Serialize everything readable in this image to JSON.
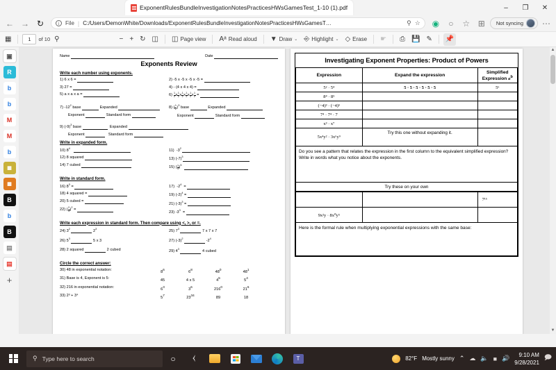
{
  "browser": {
    "tab": {
      "title": "ExponentRulesBundleInvestigationNotesPracticesHWsGamesTest_1-10 (1).pdf",
      "favicon": "pdf-icon"
    },
    "window_controls": {
      "minimize": "–",
      "maximize": "❐",
      "close": "✕"
    },
    "nav": {
      "back": "←",
      "forward": "→",
      "refresh": "↻"
    },
    "omnibox": {
      "info_glyph": "i",
      "scheme_label": "File",
      "separator": "|",
      "url": "C:/Users/DemonWhite/Downloads/ExponentRulesBundleInvestigationNotesPracticesHWsGamesT…",
      "find_icon": "search-icon",
      "favorite_icon": "star-add-icon"
    },
    "right_actions": {
      "copilot": "copilot-icon",
      "history": "history-icon",
      "favorites": "favorites-icon",
      "collections": "collections-icon",
      "profile_label": "Not syncing",
      "more": "⋯"
    }
  },
  "pdf_toolbar": {
    "sidebar_toggle": "page-panel-icon",
    "page_number": "1",
    "page_total": "of 10",
    "search": "search-icon",
    "zoom_out": "−",
    "zoom_in": "+",
    "rotate": "rotate-icon",
    "fit_page": "fit-page-icon",
    "page_view": "Page view",
    "read_aloud": "Read aloud",
    "draw": "Draw",
    "highlight": "Highlight",
    "erase": "Erase",
    "caret": "⌄",
    "select_text": "select-text-icon",
    "print": "print-icon",
    "save": "save-icon",
    "annotate": "annotate-icon",
    "pin": "pin-icon"
  },
  "edge_sidebar": {
    "items": [
      {
        "name": "browser-essentials",
        "glyph": "▣",
        "color": "#ffffff",
        "text": "#555555"
      },
      {
        "name": "app-r",
        "glyph": "R",
        "color": "#2bbbd8",
        "text": "#ffffff"
      },
      {
        "name": "app-b-1",
        "glyph": "b",
        "color": "#ffffff",
        "text": "#2f7fe0"
      },
      {
        "name": "app-b-2",
        "glyph": "b",
        "color": "#ffffff",
        "text": "#2f7fe0"
      },
      {
        "name": "app-m-red",
        "glyph": "M",
        "color": "#ffffff",
        "text": "#d93025"
      },
      {
        "name": "app-gmail",
        "glyph": "M",
        "color": "#ffffff",
        "text": "#d93025"
      },
      {
        "name": "app-b-3",
        "glyph": "b",
        "color": "#ffffff",
        "text": "#2f7fe0"
      },
      {
        "name": "app-green-card",
        "glyph": "▬",
        "color": "#c9b23a",
        "text": "#ffffff"
      },
      {
        "name": "app-orange-card",
        "glyph": "▬",
        "color": "#e07b20",
        "text": "#ffffff"
      },
      {
        "name": "app-black-b-1",
        "glyph": "B",
        "color": "#111111",
        "text": "#ffffff"
      },
      {
        "name": "app-b-4",
        "glyph": "b",
        "color": "#ffffff",
        "text": "#2f7fe0"
      },
      {
        "name": "app-black-b-2",
        "glyph": "B",
        "color": "#111111",
        "text": "#ffffff"
      },
      {
        "name": "app-grey-doc",
        "glyph": "▤",
        "color": "#ffffff",
        "text": "#8a8a8a"
      },
      {
        "name": "app-pdf-selected",
        "glyph": "▤",
        "color": "#ffffff",
        "text": "#e8443a"
      }
    ],
    "add_button": "+"
  },
  "worksheet": {
    "name_label": "Name",
    "date_label": "Date",
    "title": "Exponents Review",
    "sections": [
      {
        "heading": "Write each number using exponents.",
        "items_left": [
          "1)  6 x 6 =",
          "3)  27 =",
          "5)  a x a x a ="
        ],
        "items_right": [
          "2) -5 x -5 x -5 x -5 =",
          "4) - (4 x 4 x 4) =",
          "6)  ½ x ½ x ½ x ½ x ½ x ½  ="
        ]
      }
    ],
    "baseexp": {
      "q7": {
        "num": "7)  -12",
        "sup": "2",
        "base": "base",
        "expanded": "Expanded",
        "exponent": "Exponent",
        "standard": "Standard form"
      },
      "q8": {
        "num": "8)",
        "frac_num": "1",
        "frac_den": "2",
        "sup": "3",
        "base": "base",
        "expanded": "Expanded",
        "exponent": "Exponent",
        "standard": "Standard form"
      },
      "q9": {
        "num": "9)  (-9)",
        "sup": "3",
        "base": "base",
        "expanded": "Expanded",
        "exponent": "Exponent",
        "standard": "Standard form"
      }
    },
    "expanded_heading": "Write in expanded form.",
    "expanded_left": [
      {
        "n": "10)",
        "expr": "8",
        "sup": "4"
      },
      {
        "n": "12)",
        "expr": "8 squared",
        "sup": ""
      },
      {
        "n": "14)",
        "expr": "7 cubed",
        "sup": ""
      }
    ],
    "expanded_right": [
      {
        "n": "11)",
        "expr": "-3",
        "sup": "2"
      },
      {
        "n": "13)",
        "expr": "(-7)",
        "sup": "3"
      },
      {
        "n": "15)",
        "expr": "frac",
        "frac_num": "3",
        "frac_den": "4",
        "sup": "5"
      }
    ],
    "standard_heading": "Write in standard form.",
    "standard_left": [
      {
        "n": "16)",
        "expr": "8",
        "sup": "3",
        "eq": "="
      },
      {
        "n": "18)",
        "expr": "4 squared",
        "sup": "",
        "eq": "="
      },
      {
        "n": "20)",
        "expr": "5 cubed",
        "sup": "",
        "eq": "="
      },
      {
        "n": "22)",
        "expr": "frac",
        "frac_num": "2",
        "frac_den": "4",
        "sup": "2",
        "eq": "="
      }
    ],
    "standard_right": [
      {
        "n": "17)",
        "expr": "-2",
        "sup": "4",
        "eq": "="
      },
      {
        "n": "19)",
        "expr": "(-2)",
        "sup": "4",
        "eq": "="
      },
      {
        "n": "21)",
        "expr": "(-3)",
        "sup": "3",
        "eq": "="
      },
      {
        "n": "23)",
        "expr": "-3",
        "sup": "3",
        "eq": "="
      }
    ],
    "compare_heading": "Write each expression in standard form.  Then compare using <, >, or =.",
    "compare_left": [
      {
        "n": "24)",
        "a": "3",
        "asup": "2",
        "b": "2",
        "bsup": "3"
      },
      {
        "n": "26)",
        "a": "5",
        "asup": "3",
        "b": "5 x 3",
        "bsup": ""
      },
      {
        "n": "28)",
        "a": "2 squared",
        "asup": "",
        "b": "2 cubed",
        "bsup": ""
      }
    ],
    "compare_right": [
      {
        "n": "25)",
        "a": "7",
        "asup": "3",
        "b": "7 x 7 x 7",
        "bsup": ""
      },
      {
        "n": "27)",
        "a": "(-3)",
        "asup": "2",
        "b": "-2",
        "bsup": "4"
      },
      {
        "n": "29)",
        "a": "4",
        "asup": "3",
        "b": "4 cubed",
        "bsup": ""
      }
    ],
    "circle_heading": "Circle the correct answer:",
    "circle_rows": [
      {
        "q": "30) 48 in exponential notation:",
        "opts": [
          {
            "t": "8",
            "s": "6"
          },
          {
            "t": "6",
            "s": "8"
          },
          {
            "t": "48",
            "s": "0"
          },
          {
            "t": "48",
            "s": "1"
          }
        ]
      },
      {
        "q": "31) Base is 4, Exponent is 5:",
        "opts": [
          {
            "t": "45",
            "s": ""
          },
          {
            "t": "4 x 5",
            "s": ""
          },
          {
            "t": "4",
            "s": "5"
          },
          {
            "t": "5",
            "s": "4"
          }
        ]
      },
      {
        "q": "32)  216 in exponential notation:",
        "opts": [
          {
            "t": "6",
            "s": "3"
          },
          {
            "t": "3",
            "s": "6"
          },
          {
            "t": "216",
            "s": "0"
          },
          {
            "t": "21",
            "s": "6"
          }
        ]
      },
      {
        "q": "33)  2³ + 3⁴",
        "opts": [
          {
            "t": "5",
            "s": "7"
          },
          {
            "t": "23",
            "s": "34"
          },
          {
            "t": "89",
            "s": ""
          },
          {
            "t": "18",
            "s": ""
          }
        ]
      }
    ]
  },
  "investigation": {
    "title": "Investigating Exponent Properties: Product of Powers",
    "headers": {
      "c1": "Expression",
      "c2": "Expand the expression",
      "c3_line1": "Simplified",
      "c3_line2": "Expression ",
      "c3_italic": "a",
      "c3_sup": "b"
    },
    "rows": [
      {
        "expression": "5² · 5⁴",
        "expand": "5 · 5 · 5 · 5 · 5 · 5",
        "simplified": "5⁶"
      },
      {
        "expression": "8⁴ · 8⁵",
        "expand": "",
        "simplified": ""
      },
      {
        "expression": "(−4)³ · (−4)⁵",
        "expand": "",
        "simplified": ""
      },
      {
        "expression": "7⁴ · 7⁴ · 7",
        "expand": "",
        "simplified": ""
      },
      {
        "expression": "x³ · x⁷",
        "expand": "",
        "simplified": ""
      },
      {
        "expression": "5x⁴y² · 3x⁶y⁹",
        "expand": "Try this one without expanding it.",
        "simplified": ""
      }
    ],
    "pattern_prompt": "Do you see a pattern that relates the expression in the first column to the equivalent simplified expression?  Write in words what you notice about the exponents.",
    "try_band": "Try these on your own",
    "try_rows": [
      {
        "expression": "",
        "expand": "",
        "simplified": "7¹⁵"
      },
      {
        "expression": "9x²y · 8x⁰y⁵",
        "expand": "",
        "simplified": ""
      }
    ],
    "formal_rule": "Here is the formal rule when multiplying exponential expressions with the same base:"
  },
  "taskbar": {
    "search_placeholder": "Type here to search",
    "items": [
      {
        "name": "cortana-icon",
        "glyph": "○"
      },
      {
        "name": "task-view-icon",
        "glyph": "⫼"
      },
      {
        "name": "file-explorer-icon",
        "glyph": "🗀"
      },
      {
        "name": "microsoft-store-icon",
        "glyph": "🛍"
      },
      {
        "name": "mail-icon",
        "glyph": "✉"
      },
      {
        "name": "microsoft-edge-icon",
        "glyph": "◑"
      },
      {
        "name": "microsoft-teams-icon",
        "glyph": "⬟"
      }
    ],
    "weather": {
      "temp": "82°F",
      "condition": "Mostly sunny"
    },
    "tray": {
      "show_hidden": "⌃",
      "onedrive": "onedrive-icon",
      "mic": "microphone-icon",
      "battery": "battery-icon",
      "volume": "volume-icon"
    },
    "clock": {
      "time": "9:10 AM",
      "date": "9/28/2021"
    },
    "notifications": "action-center-icon"
  }
}
